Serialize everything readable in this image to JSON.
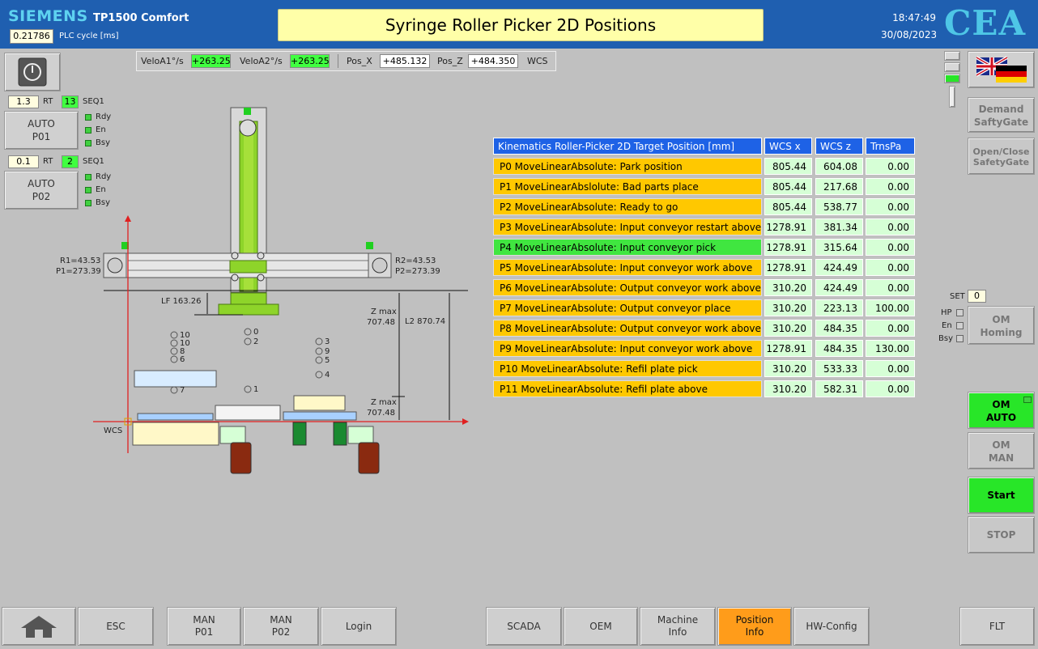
{
  "header": {
    "brand": "SIEMENS",
    "model": "TP1500 Comfort",
    "plc_cycle_value": "0.21786",
    "plc_cycle_label": "PLC cycle [ms]",
    "title": "Syringe Roller Picker 2D Positions",
    "time": "18:47:49",
    "date": "30/08/2023",
    "logo": "CEA"
  },
  "speedbar": {
    "velo_a1_label": "VeloA1°/s",
    "velo_a1_value": "+263.25",
    "velo_a2_label": "VeloA2°/s",
    "velo_a2_value": "+263.25",
    "pos_x_label": "Pos_X",
    "pos_x_value": "+485.132",
    "pos_z_label": "Pos_Z",
    "pos_z_value": "+484.350",
    "frame_label": "WCS"
  },
  "left_panel": {
    "power_icon": "power-icon",
    "p01": {
      "rt_value": "1.3",
      "rt_label": "RT",
      "seq_value": "13",
      "seq_label": "SEQ1",
      "button": "AUTO\nP01",
      "rdy": "Rdy",
      "en": "En",
      "bsy": "Bsy"
    },
    "p02": {
      "rt_value": "0.1",
      "rt_label": "RT",
      "seq_value": "2",
      "seq_label": "SEQ1",
      "button": "AUTO\nP02",
      "rdy": "Rdy",
      "en": "En",
      "bsy": "Bsy"
    }
  },
  "diagram": {
    "r1": "R1=43.53",
    "p1": "P1=273.39",
    "r2": "R2=43.53",
    "p2": "P2=273.39",
    "lf": "LF 163.26",
    "zmax_top_1": "Z max",
    "zmax_top_2": "707.48",
    "l2": "L2 870.74",
    "zmax_bot_1": "Z max",
    "zmax_bot_2": "707.48",
    "wcs": "WCS",
    "points": [
      "10",
      "10",
      "8",
      "6",
      "0",
      "2",
      "3",
      "9",
      "5",
      "4",
      "7",
      "1"
    ]
  },
  "table": {
    "headers": [
      "Kinematics Roller-Picker 2D Target Position [mm]",
      "WCS x",
      "WCS z",
      "TrnsPa"
    ],
    "rows": [
      {
        "name": "P0 MoveLinearAbsolute: Park position",
        "x": "805.44",
        "z": "604.08",
        "t": "0.00"
      },
      {
        "name": "P1 MoveLinearAbslolute: Bad parts place",
        "x": "805.44",
        "z": "217.68",
        "t": "0.00"
      },
      {
        "name": "P2 MoveLinearAbsolute: Ready to go",
        "x": "805.44",
        "z": "538.77",
        "t": "0.00"
      },
      {
        "name": "P3 MoveLinearAbsolute: Input conveyor restart above",
        "x": "1278.91",
        "z": "381.34",
        "t": "0.00"
      },
      {
        "name": "P4 MoveLinearAbsolute: Input conveyor pick",
        "x": "1278.91",
        "z": "315.64",
        "t": "0.00"
      },
      {
        "name": "P5 MoveLinearAbsolute: Input conveyor work above",
        "x": "1278.91",
        "z": "424.49",
        "t": "0.00"
      },
      {
        "name": "P6 MoveLinearAbsolute: Output conveyor work above",
        "x": "310.20",
        "z": "424.49",
        "t": "0.00"
      },
      {
        "name": "P7 MoveLinearAbsolute: Output conveyor place",
        "x": "310.20",
        "z": "223.13",
        "t": "100.00"
      },
      {
        "name": "P8 MoveLinearAbsolute: Output conveyor work above",
        "x": "310.20",
        "z": "484.35",
        "t": "0.00"
      },
      {
        "name": "P9 MoveLinearAbsolute: Input conveyor work above",
        "x": "1278.91",
        "z": "484.35",
        "t": "130.00"
      },
      {
        "name": "P10 MoveLinearAbsolute: Refil plate pick",
        "x": "310.20",
        "z": "533.33",
        "t": "0.00"
      },
      {
        "name": "P11 MoveLinearAbsolute: Refil plate above",
        "x": "310.20",
        "z": "582.31",
        "t": "0.00"
      }
    ],
    "active_row": 4
  },
  "right_panel": {
    "demand_safety": "Demand\nSaftyGate",
    "open_close_safety": "Open/Close\nSafetyGate",
    "set_label": "SET",
    "set_value": "0",
    "hp": "HP",
    "en": "En",
    "bsy": "Bsy",
    "om_homing": "OM\nHoming",
    "om_auto": "OM\nAUTO",
    "om_man": "OM\nMAN",
    "start": "Start",
    "stop": "STOP"
  },
  "nav": {
    "home_icon": "home-icon",
    "esc": "ESC",
    "man_p01": "MAN\nP01",
    "man_p02": "MAN\nP02",
    "login": "Login",
    "scada": "SCADA",
    "oem": "OEM",
    "machine_info": "Machine\nInfo",
    "position_info": "Position\nInfo",
    "hw_config": "HW-Config",
    "flt": "FLT"
  },
  "colors": {
    "header_bg": "#1f5fb0",
    "title_bg": "#ffffa8",
    "table_header": "#1e62e6",
    "row_default": "#ffc800",
    "row_active": "#40e640",
    "cell_bg": "#d6ffd6",
    "nav_active": "#ff9c1a",
    "om_green": "#28e628"
  }
}
